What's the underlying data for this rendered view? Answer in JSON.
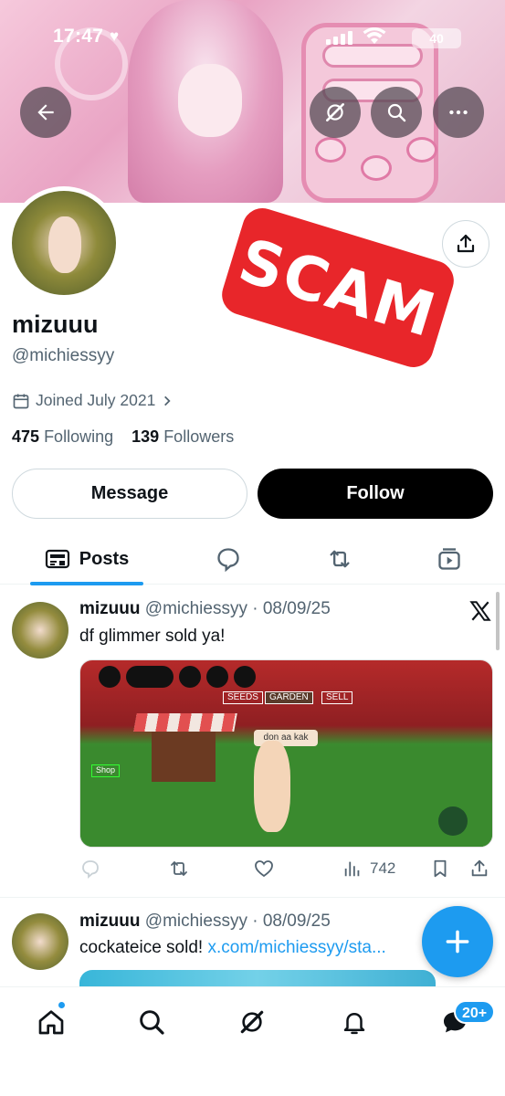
{
  "status_bar": {
    "time": "17:47",
    "battery": "40"
  },
  "profile": {
    "name": "mizuuu",
    "handle": "@michiessyy",
    "joined": "Joined July 2021",
    "following_count": "475",
    "following_label": "Following",
    "followers_count": "139",
    "followers_label": "Followers"
  },
  "overlay": {
    "scam_label": "SCAM"
  },
  "buttons": {
    "message": "Message",
    "follow": "Follow"
  },
  "tabs": [
    {
      "label": "Posts"
    }
  ],
  "posts": [
    {
      "name": "mizuuu",
      "meta": "@michiessyy · 08/09/25",
      "text": "df glimmer sold ya!",
      "media": {
        "labels": {
          "seeds": "SEEDS",
          "garden": "GARDEN",
          "sell": "SELL",
          "shop": "Shop",
          "player": "don  aa kak"
        }
      },
      "views": "742"
    },
    {
      "name": "mizuuu",
      "meta": "@michiessyy · 08/09/25",
      "text": "cockateice sold! ",
      "link": "x.com/michiessyy/sta..."
    }
  ],
  "bottom_nav": {
    "badge": "20+"
  },
  "colors": {
    "accent": "#1d9bf0",
    "scam": "#e8262a"
  }
}
